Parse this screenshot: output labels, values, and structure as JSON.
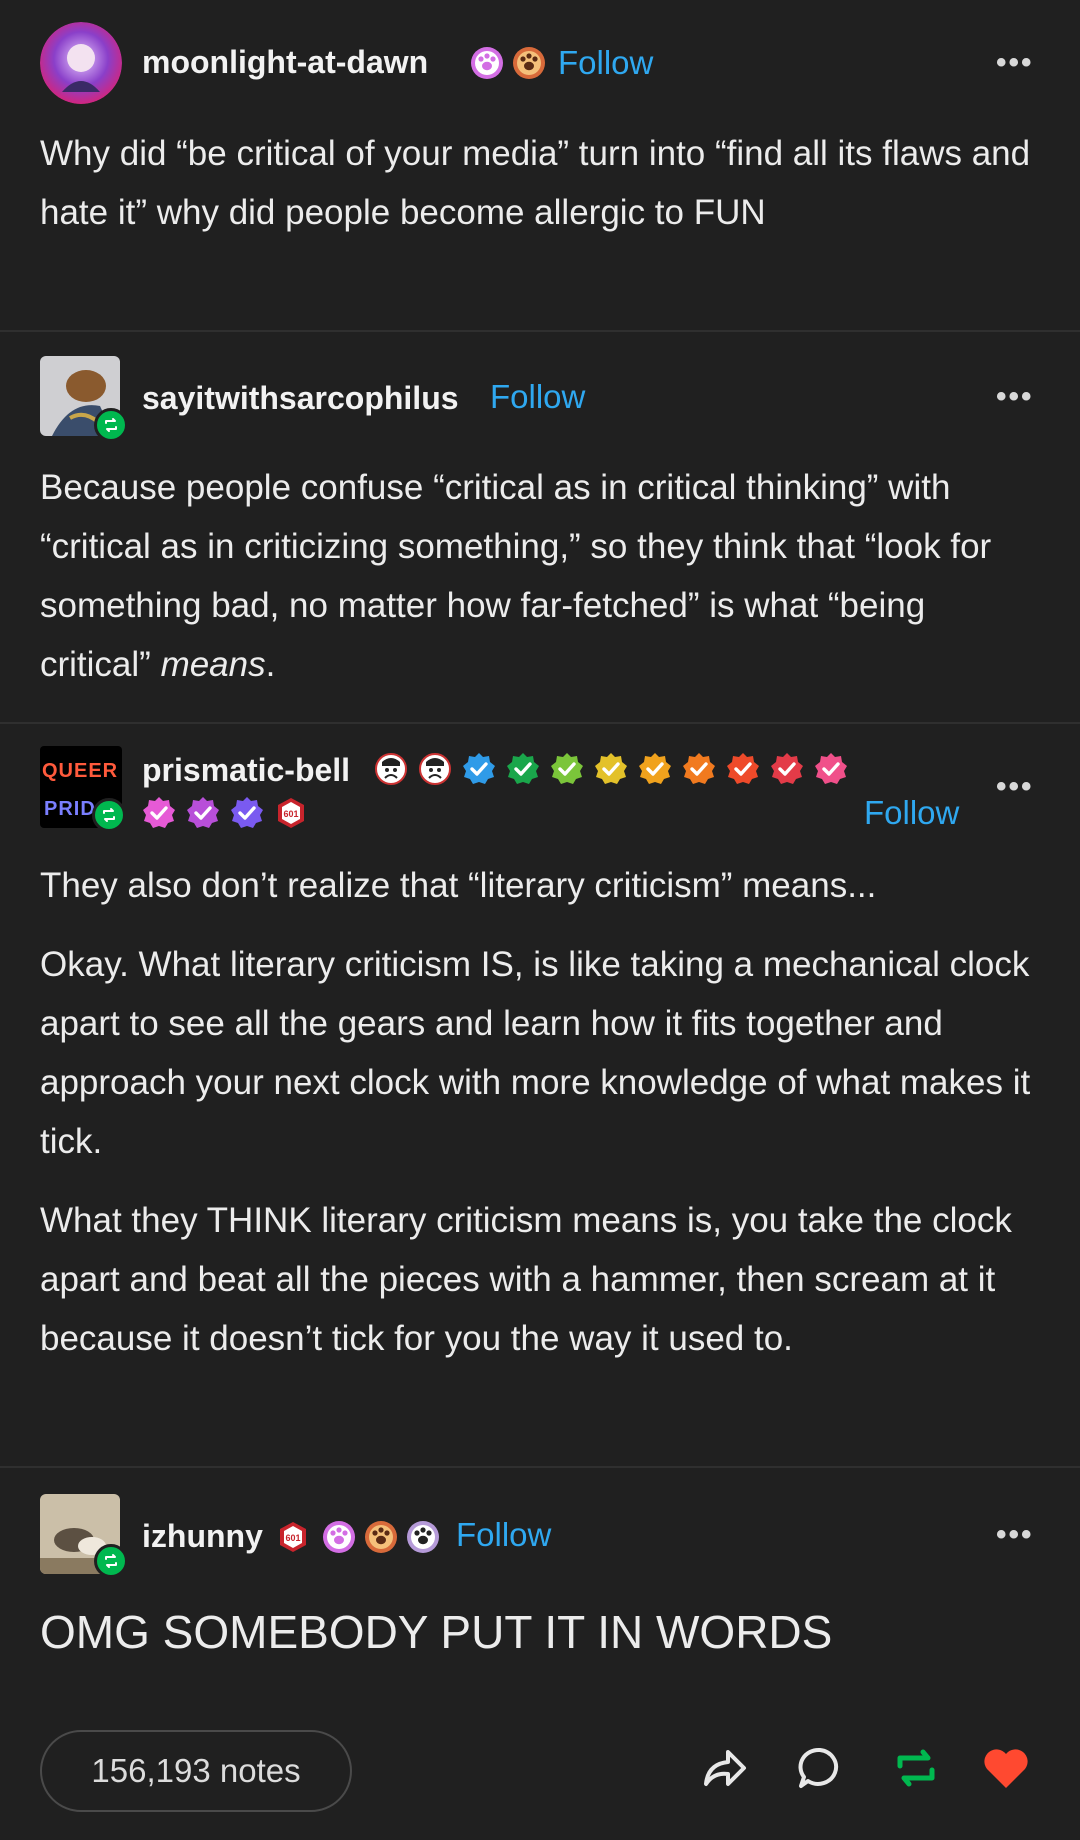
{
  "posts": [
    {
      "username": "moonlight-at-dawn",
      "follow": "Follow",
      "more": "•••",
      "paragraphs": [
        "Why did “be critical of your media” turn into “find all its flaws and hate it” why did people become allergic to FUN"
      ]
    },
    {
      "username": "sayitwithsarcophilus",
      "follow": "Follow",
      "more": "•••",
      "paragraphs": [
        "Because people confuse “critical as in critical thinking” with “critical as in criticizing something,” so they think that “look for something bad, no matter how far-fetched” is what “being critical” ",
        "means",
        "."
      ]
    },
    {
      "username": "prismatic-bell",
      "follow": "Follow",
      "more": "•••",
      "avatar_text_1": "QUEER",
      "avatar_text_2": "PRID",
      "paragraphs": [
        "They also don’t realize that “literary criticism” means...",
        "Okay. What literary criticism IS, is like taking a mechanical clock apart to see all the gears and learn how it fits together and approach your next clock with more knowledge of what makes it tick.",
        "What they THINK literary criticism means is, you take the clock apart and beat all the pieces with a hammer, then scream at it because it doesn’t tick for you the way it used to."
      ]
    },
    {
      "username": "izhunny",
      "follow": "Follow",
      "more": "•••",
      "paragraphs": [
        "OMG SOMEBODY PUT IT IN WORDS"
      ]
    }
  ],
  "badge_text": "601",
  "footer": {
    "notes": "156,193 notes",
    "actions": [
      "share-icon",
      "reply-icon",
      "reblog-icon",
      "like-icon"
    ]
  },
  "colors": {
    "background": "#202020",
    "follow": "#2fa8f0",
    "reblog": "#00b84f",
    "like": "#ff4930"
  }
}
